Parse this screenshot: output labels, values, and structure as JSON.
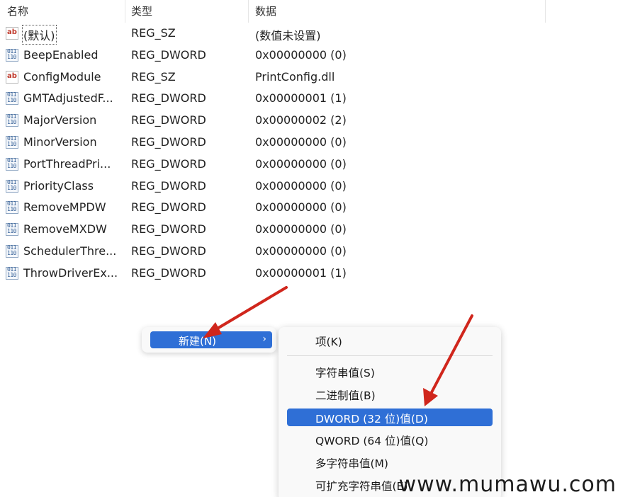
{
  "columns": {
    "name": "名称",
    "type": "类型",
    "data": "数据"
  },
  "rows": [
    {
      "icon": "string-value-icon",
      "name": "(默认)",
      "type": "REG_SZ",
      "data": "(数值未设置)"
    },
    {
      "icon": "binary-value-icon",
      "name": "BeepEnabled",
      "type": "REG_DWORD",
      "data": "0x00000000 (0)"
    },
    {
      "icon": "string-value-icon",
      "name": "ConfigModule",
      "type": "REG_SZ",
      "data": "PrintConfig.dll"
    },
    {
      "icon": "binary-value-icon",
      "name": "GMTAdjustedF...",
      "type": "REG_DWORD",
      "data": "0x00000001 (1)"
    },
    {
      "icon": "binary-value-icon",
      "name": "MajorVersion",
      "type": "REG_DWORD",
      "data": "0x00000002 (2)"
    },
    {
      "icon": "binary-value-icon",
      "name": "MinorVersion",
      "type": "REG_DWORD",
      "data": "0x00000000 (0)"
    },
    {
      "icon": "binary-value-icon",
      "name": "PortThreadPri...",
      "type": "REG_DWORD",
      "data": "0x00000000 (0)"
    },
    {
      "icon": "binary-value-icon",
      "name": "PriorityClass",
      "type": "REG_DWORD",
      "data": "0x00000000 (0)"
    },
    {
      "icon": "binary-value-icon",
      "name": "RemoveMPDW",
      "type": "REG_DWORD",
      "data": "0x00000000 (0)"
    },
    {
      "icon": "binary-value-icon",
      "name": "RemoveMXDW",
      "type": "REG_DWORD",
      "data": "0x00000000 (0)"
    },
    {
      "icon": "binary-value-icon",
      "name": "SchedulerThre...",
      "type": "REG_DWORD",
      "data": "0x00000000 (0)"
    },
    {
      "icon": "binary-value-icon",
      "name": "ThrowDriverEx...",
      "type": "REG_DWORD",
      "data": "0x00000001 (1)"
    }
  ],
  "icon_text": {
    "string": "ab",
    "binary": "011\n110"
  },
  "context_menu": {
    "new_label": "新建(N)",
    "submenu_arrow": "›"
  },
  "submenu": {
    "key": "项(K)",
    "string_value": "字符串值(S)",
    "binary_value": "二进制值(B)",
    "dword_value": "DWORD (32 位)值(D)",
    "qword_value": "QWORD (64 位)值(Q)",
    "multi_string_value": "多字符串值(M)",
    "expandable_string_value": "可扩充字符串值(E)"
  },
  "colors": {
    "highlight": "#2f6fd6",
    "annotation_arrow": "#d0261c"
  },
  "watermark": "www.mumawu.com"
}
